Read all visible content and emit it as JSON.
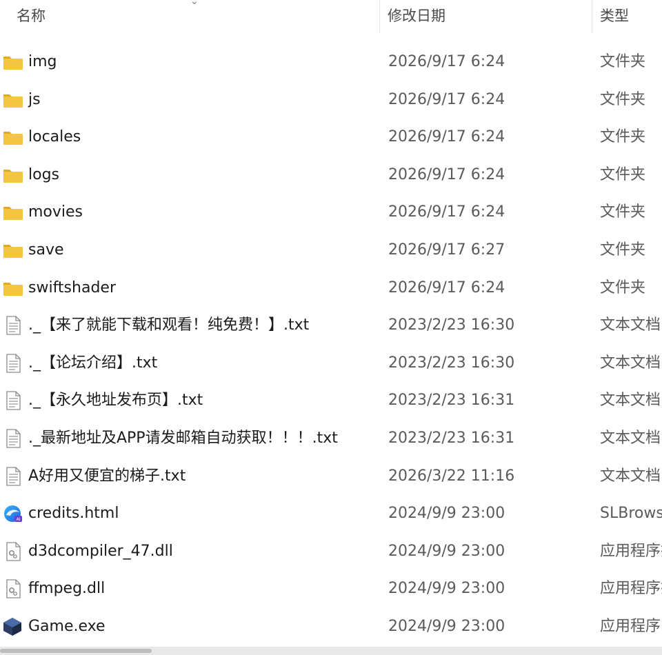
{
  "columns": {
    "name": "名称",
    "date": "修改日期",
    "type": "类型"
  },
  "files": [
    {
      "name": "img",
      "date": "2026/9/17 6:24",
      "type": "文件夹",
      "icon": "folder-icon"
    },
    {
      "name": "js",
      "date": "2026/9/17 6:24",
      "type": "文件夹",
      "icon": "folder-icon"
    },
    {
      "name": "locales",
      "date": "2026/9/17 6:24",
      "type": "文件夹",
      "icon": "folder-icon"
    },
    {
      "name": "logs",
      "date": "2026/9/17 6:24",
      "type": "文件夹",
      "icon": "folder-icon"
    },
    {
      "name": "movies",
      "date": "2026/9/17 6:24",
      "type": "文件夹",
      "icon": "folder-icon"
    },
    {
      "name": "save",
      "date": "2026/9/17 6:27",
      "type": "文件夹",
      "icon": "folder-icon"
    },
    {
      "name": "swiftshader",
      "date": "2026/9/17 6:24",
      "type": "文件夹",
      "icon": "folder-icon"
    },
    {
      "name": "._【来了就能下载和观看！纯免费！】.txt",
      "date": "2023/2/23 16:30",
      "type": "文本文档",
      "icon": "text-file-icon"
    },
    {
      "name": "._【论坛介绍】.txt",
      "date": "2023/2/23 16:30",
      "type": "文本文档",
      "icon": "text-file-icon"
    },
    {
      "name": "._【永久地址发布页】.txt",
      "date": "2023/2/23 16:31",
      "type": "文本文档",
      "icon": "text-file-icon"
    },
    {
      "name": "._最新地址及APP请发邮箱自动获取！！！.txt",
      "date": "2023/2/23 16:31",
      "type": "文本文档",
      "icon": "text-file-icon"
    },
    {
      "name": "A好用又便宜的梯子.txt",
      "date": "2026/3/22 11:16",
      "type": "文本文档",
      "icon": "text-file-icon"
    },
    {
      "name": "credits.html",
      "date": "2024/9/9 23:00",
      "type": "SLBrowser",
      "icon": "browser-html-icon"
    },
    {
      "name": "d3dcompiler_47.dll",
      "date": "2024/9/9 23:00",
      "type": "应用程序扩展",
      "icon": "dll-file-icon"
    },
    {
      "name": "ffmpeg.dll",
      "date": "2024/9/9 23:00",
      "type": "应用程序扩展",
      "icon": "dll-file-icon"
    },
    {
      "name": "Game.exe",
      "date": "2024/9/9 23:00",
      "type": "应用程序",
      "icon": "game-exe-icon"
    }
  ],
  "colors": {
    "folder": "#f4c542",
    "folder_dark": "#e3a91f",
    "header_text": "#4a4a4a",
    "row_text": "#1b1b1b",
    "meta_text": "#5a5a5a"
  }
}
